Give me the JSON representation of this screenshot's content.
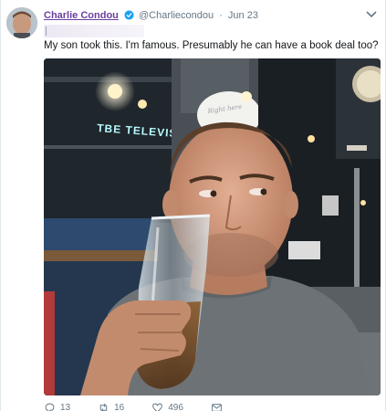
{
  "tweet": {
    "display_name": "Charlie Condou",
    "handle": "@Charliecondou",
    "separator": "·",
    "date": "Jun 23",
    "text": "My son took this. I'm famous. Presumably he can have a book deal too?",
    "sign_text": "TBE TELEVISO",
    "window_text": "Right here"
  },
  "actions": {
    "reply_count": "13",
    "retweet_count": "16",
    "like_count": "496"
  },
  "icons": {
    "avatar": "profile-photo",
    "verified": "verified-badge-icon",
    "caret": "chevron-down-icon",
    "reply": "reply-icon",
    "retweet": "retweet-icon",
    "like": "heart-icon",
    "dm": "envelope-icon"
  },
  "colors": {
    "name": "#6b3fa0",
    "meta": "#657786",
    "verified": "#1da1f2",
    "text": "#14171a"
  }
}
